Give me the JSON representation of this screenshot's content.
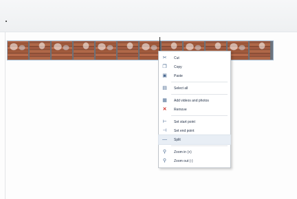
{
  "window": {
    "title": ""
  },
  "timeline": {
    "frame_count": 12
  },
  "context_menu": {
    "items": [
      {
        "label": "Cut",
        "icon": "cut-icon"
      },
      {
        "label": "Copy",
        "icon": "copy-icon"
      },
      {
        "label": "Paste",
        "icon": "paste-icon"
      },
      {
        "label": "Select all",
        "icon": "select-all-icon"
      },
      {
        "label": "Add videos and photos",
        "icon": "add-media-icon"
      },
      {
        "label": "Remove",
        "icon": "remove-icon"
      },
      {
        "label": "Set start point",
        "icon": "set-start-icon"
      },
      {
        "label": "Set end point",
        "icon": "set-end-icon"
      },
      {
        "label": "Split",
        "icon": "split-icon"
      },
      {
        "label": "Zoom in (+)",
        "icon": "zoom-in-icon"
      },
      {
        "label": "Zoom out (-)",
        "icon": "zoom-out-icon"
      }
    ],
    "highlighted_item": "Split"
  },
  "colors": {
    "accent": "#4b6a92",
    "remove": "#d02b24",
    "highlight": "#e8eef5"
  }
}
